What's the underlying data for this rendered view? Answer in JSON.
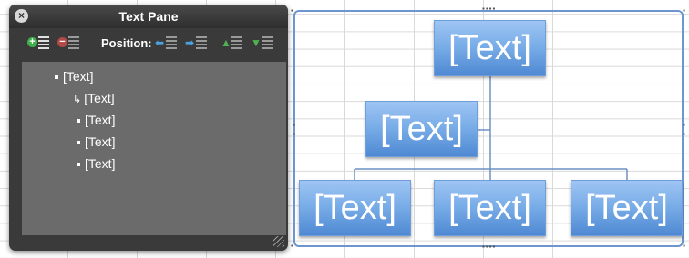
{
  "text_pane": {
    "title": "Text Pane",
    "close_icon": "close-icon",
    "toolbar": {
      "position_label": "Position:",
      "buttons": [
        {
          "name": "add-bullet-button",
          "icon": "plus-list-icon"
        },
        {
          "name": "remove-bullet-button",
          "icon": "minus-list-icon"
        },
        {
          "name": "promote-button",
          "icon": "arrow-left-list-icon"
        },
        {
          "name": "demote-button",
          "icon": "arrow-right-list-icon"
        },
        {
          "name": "move-up-button",
          "icon": "arrow-up-list-icon"
        },
        {
          "name": "move-down-button",
          "icon": "arrow-down-list-icon"
        }
      ]
    },
    "outline": [
      {
        "text": "[Text]",
        "level": 1,
        "marker": "bullet"
      },
      {
        "text": "[Text]",
        "level": 2,
        "marker": "sub-arrow"
      },
      {
        "text": "[Text]",
        "level": 2,
        "marker": "bullet"
      },
      {
        "text": "[Text]",
        "level": 2,
        "marker": "bullet"
      },
      {
        "text": "[Text]",
        "level": 2,
        "marker": "bullet"
      }
    ]
  },
  "smartart": {
    "nodes": {
      "top": "[Text]",
      "assistant": "[Text]",
      "child_1": "[Text]",
      "child_2": "[Text]",
      "child_3": "[Text]"
    }
  },
  "colors": {
    "pane_background": "#3a3a3a",
    "pane_body": "#6b6b6b",
    "node_top": "#9ec4f3",
    "node_bottom": "#4f89d3",
    "frame_border": "#6d95cf",
    "add_icon": "#3fb14a",
    "remove_icon": "#d9534f",
    "promote_icon": "#4aa3df",
    "move_icon": "#4fb34f"
  }
}
